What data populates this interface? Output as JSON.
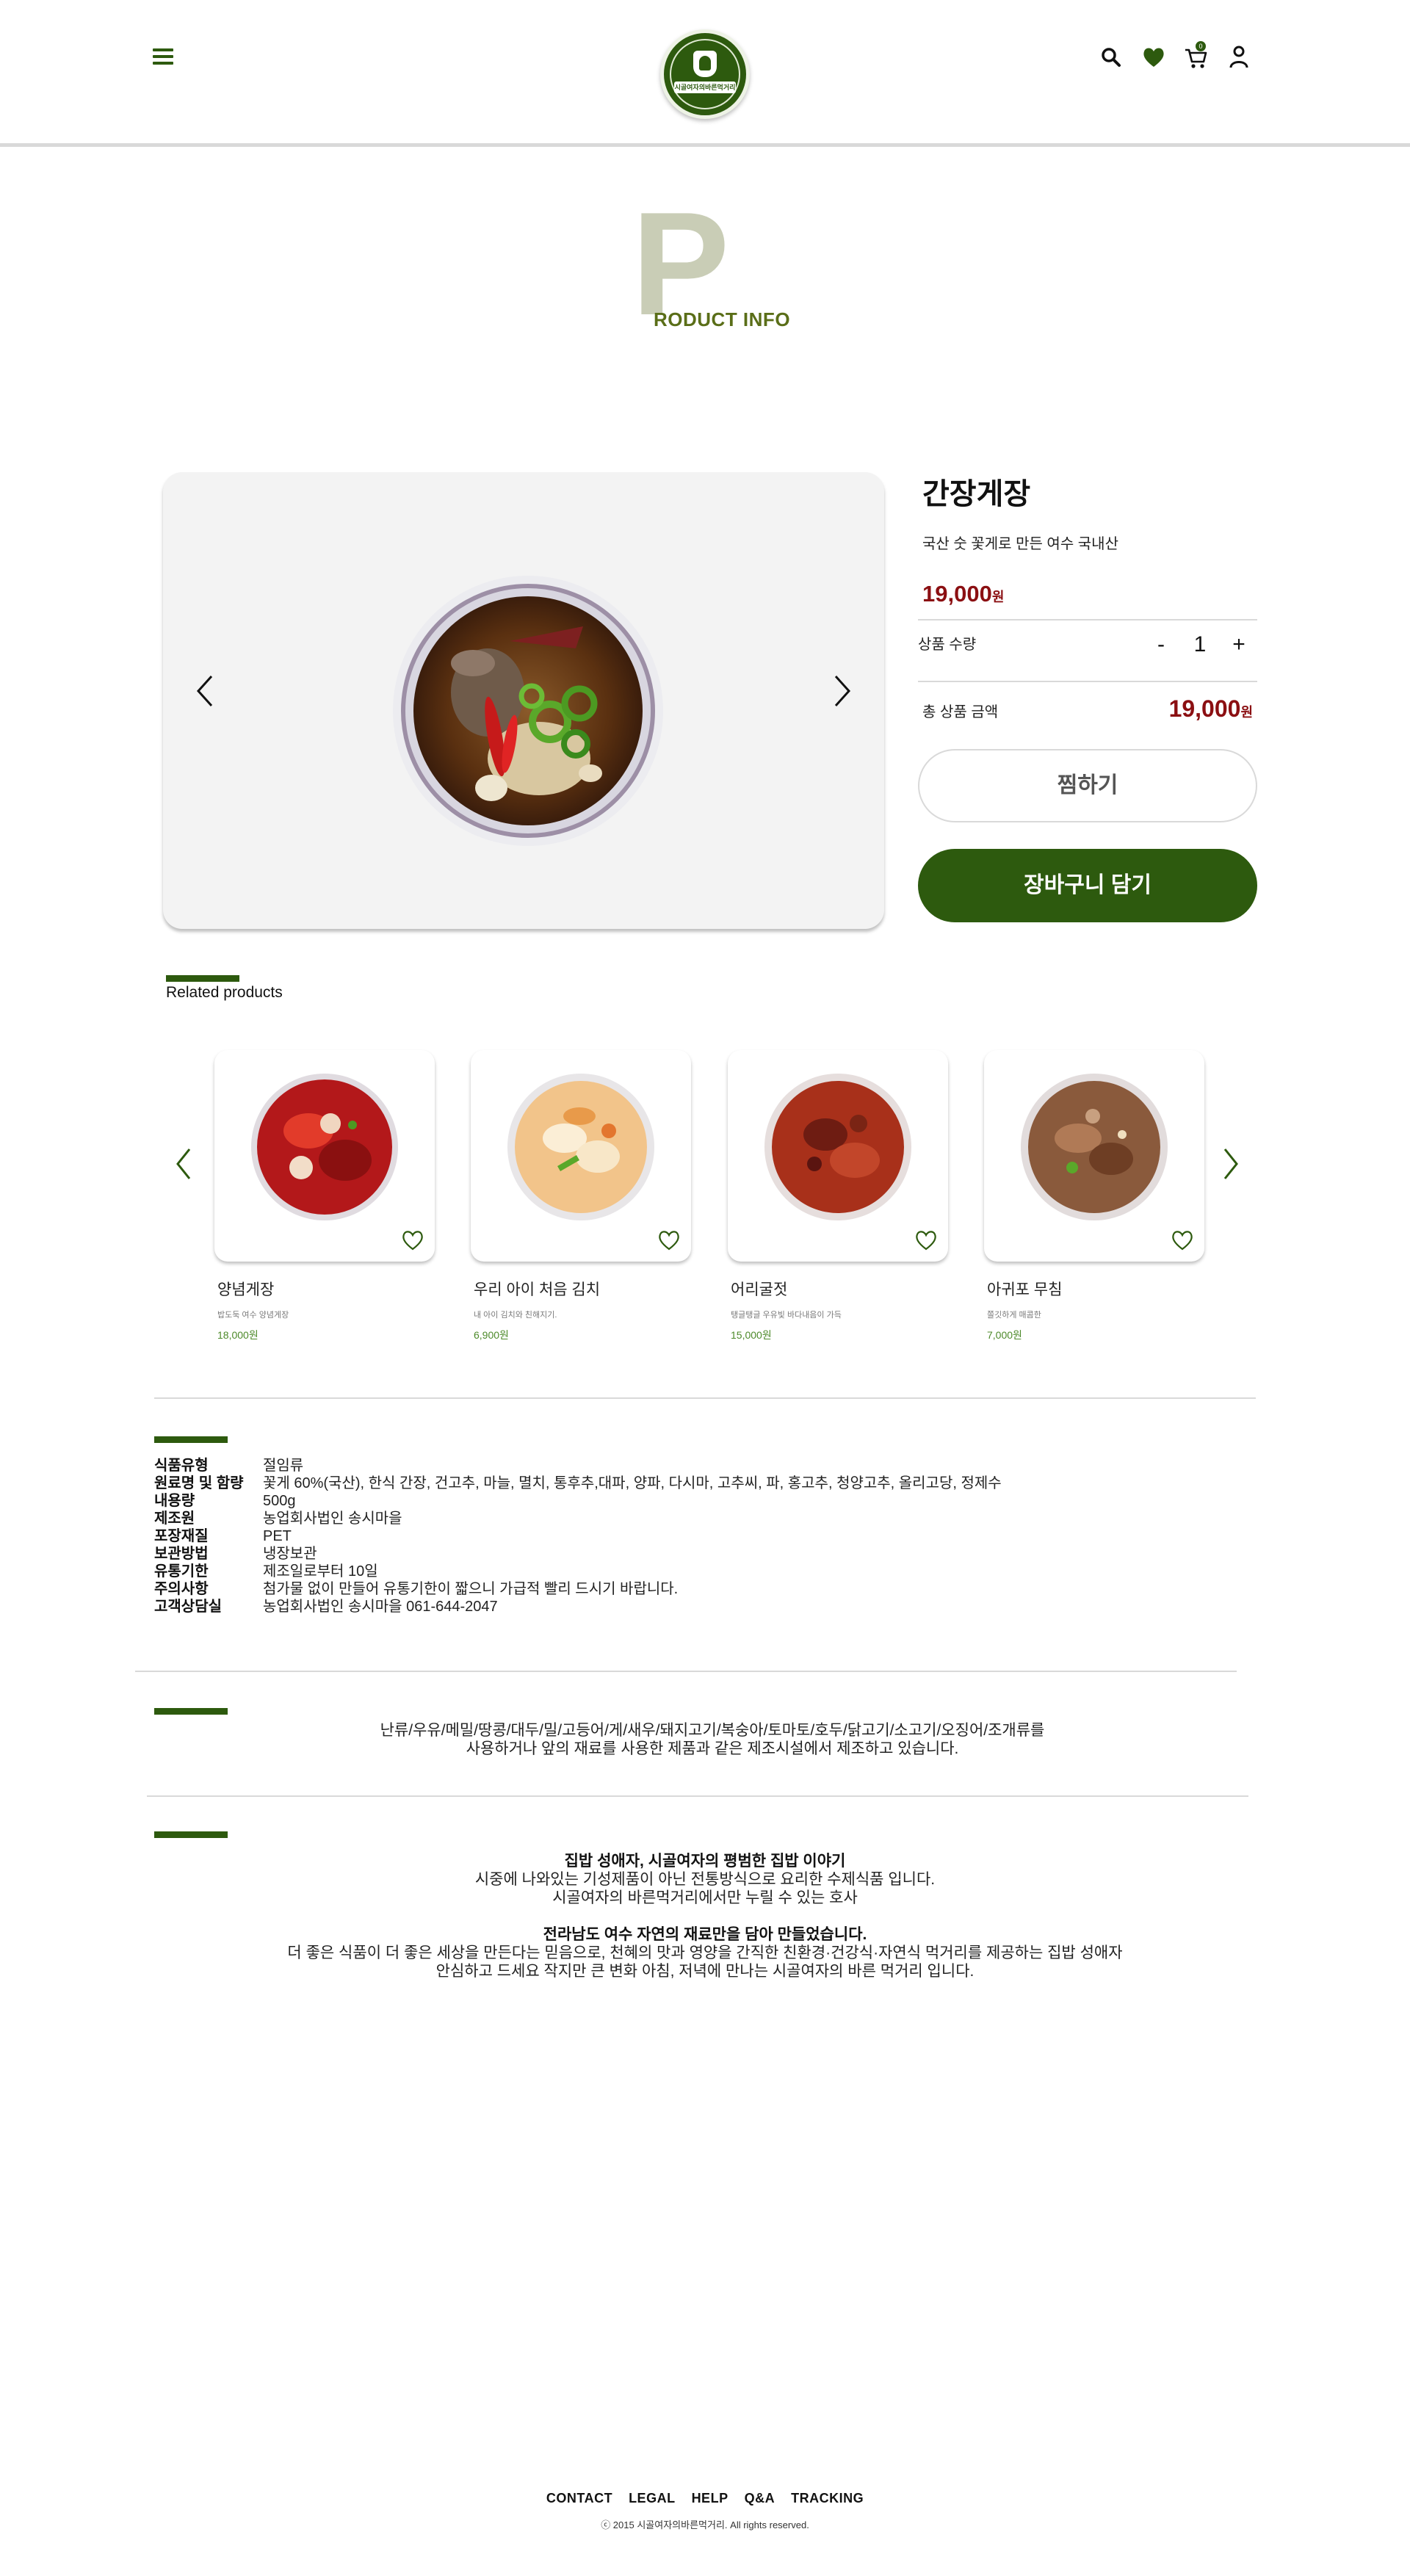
{
  "header": {
    "logo_text": "시골여자의바른먹거리",
    "cart_count": "0",
    "icons": [
      "menu-icon",
      "search-icon",
      "heart-icon",
      "cart-icon",
      "user-icon"
    ]
  },
  "section": {
    "letter": "P",
    "title": "RODUCT INFO"
  },
  "product": {
    "name": "간장게장",
    "description": "국산 숫 꽃게로 만든 여수 국내산",
    "price": "19,000",
    "currency": "원",
    "quantity_label": "상품 수량",
    "quantity": "1",
    "minus": "-",
    "plus": "+",
    "total_label": "총 상품 금액",
    "total": "19,000",
    "wish_button": "찜하기",
    "cart_button": "장바구니 담기"
  },
  "related": {
    "title": "Related products",
    "items": [
      {
        "name": "양념게장",
        "desc": "밥도둑 여수 양념게장",
        "price": "18,000원"
      },
      {
        "name": "우리 아이 처음 김치",
        "desc": "내 아이 김치와 친해지기.",
        "price": "6,900원"
      },
      {
        "name": "어리굴젓",
        "desc": "탱글탱글 우유빛 바다내음이 가득",
        "price": "15,000원"
      },
      {
        "name": "아귀포 무침",
        "desc": "쫄깃하게 매콤한",
        "price": "7,000원"
      }
    ]
  },
  "info": [
    {
      "k": "식품유형",
      "v": "절임류"
    },
    {
      "k": "원료명 및 함량",
      "v": "꽃게 60%(국산), 한식 간장, 건고추, 마늘, 멸치, 통후추,대파, 양파, 다시마, 고추씨, 파, 홍고추, 청양고추, 올리고당, 정제수"
    },
    {
      "k": "내용량",
      "v": "500g"
    },
    {
      "k": "제조원",
      "v": "농업회사법인 송시마을"
    },
    {
      "k": "포장재질",
      "v": "PET"
    },
    {
      "k": "보관방법",
      "v": "냉장보관"
    },
    {
      "k": "유통기한",
      "v": "제조일로부터 10일"
    },
    {
      "k": "주의사항",
      "v": "첨가물 없이 만들어 유통기한이 짧으니 가급적 빨리 드시기 바랍니다."
    },
    {
      "k": "고객상담실",
      "v": "농업회사법인 송시마을 061-644-2047"
    }
  ],
  "allergy": {
    "line1": "난류/우유/메밀/땅콩/대두/밀/고등어/게/새우/돼지고기/복숭아/토마토/호두/닭고기/소고기/오징어/조개류를",
    "line2": "사용하거나 앞의 재료를 사용한 제품과 같은 제조시설에서 제조하고 있습니다."
  },
  "story": {
    "title1": "집밥 성애자, 시골여자의 평범한 집밥 이야기",
    "p1": "시중에 나와있는 기성제품이 아닌 전통방식으로 요리한 수제식품 입니다.",
    "p2": "시골여자의 바른먹거리에서만 누릴 수 있는 호사",
    "title2": "전라남도 여수 자연의 재료만을 담아 만들었습니다.",
    "p3": "더 좋은 식품이 더 좋은 세상을 만든다는 믿음으로, 천혜의 맛과 영양을 간직한 친환경·건강식·자연식 먹거리를 제공하는 집밥 성애자",
    "p4": "안심하고 드세요 작지만 큰 변화 아침, 저녁에 만나는 시골여자의 바른 먹거리 입니다."
  },
  "footer": {
    "links": [
      "CONTACT",
      "LEGAL",
      "HELP",
      "Q&A",
      "TRACKING"
    ],
    "copyright": "ⓒ 2015 시골여자의바른먹거리. All rights reserved."
  },
  "colors": {
    "brand_green": "#2d5a0e",
    "price_red": "#8b0f12",
    "accent_letter": "#c9cdb6"
  }
}
